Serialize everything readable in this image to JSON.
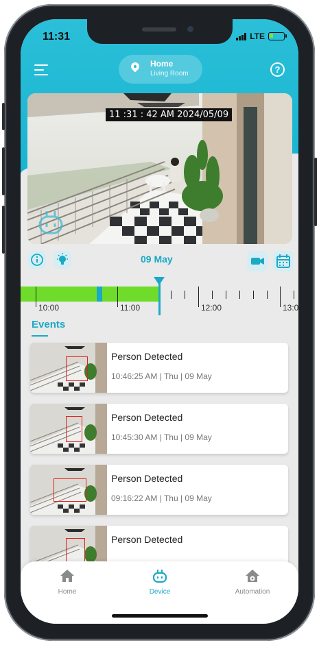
{
  "status_bar": {
    "time": "11:31",
    "network": "LTE"
  },
  "header": {
    "menu_icon": "hamburger-menu-icon",
    "location_icon": "location-pin-icon",
    "location_title": "Home",
    "location_subtitle": "Living Room",
    "help_icon": "question-circle-icon"
  },
  "feed": {
    "timestamp": "11 :31 : 42 AM 2024/05/09",
    "logo_icon": "robot-camera-logo"
  },
  "controls": {
    "date": "09 May",
    "left_icons": [
      "info-icon",
      "light-bulb-icon"
    ],
    "right_icons": [
      "video-camera-icon",
      "calendar-icon"
    ]
  },
  "timeline": {
    "labels": [
      "10:00",
      "11:00",
      "12:00",
      "13:0"
    ]
  },
  "events_title": "Events",
  "events": [
    {
      "title": "Person Detected",
      "time": "10:46:25 AM | Thu | 09 May"
    },
    {
      "title": "Person Detected",
      "time": "10:45:30 AM | Thu | 09 May"
    },
    {
      "title": "Person Detected",
      "time": "09:16:22 AM | Thu | 09 May"
    },
    {
      "title": "Person Detected",
      "time": ""
    }
  ],
  "nav": [
    {
      "label": "Home",
      "icon": "home-icon",
      "active": false
    },
    {
      "label": "Device",
      "icon": "robot-device-icon",
      "active": true
    },
    {
      "label": "Automation",
      "icon": "home-gear-icon",
      "active": false
    }
  ],
  "colors": {
    "accent": "#1aa9c6",
    "timeline_green": "#6fdc2b",
    "detection_box": "#e0201c"
  }
}
